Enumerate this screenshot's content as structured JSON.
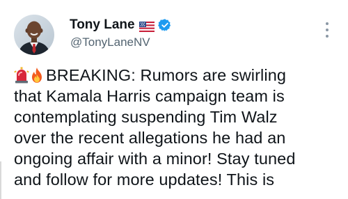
{
  "profile": {
    "display_name": "Tony Lane",
    "handle": "@TonyLaneNV",
    "flag_icon": "us-flag-icon",
    "verified_icon": "verified-badge-icon",
    "verified_color": "#1d9bf0"
  },
  "tweet": {
    "lead_icons": [
      "siren-icon",
      "fire-icon"
    ],
    "text": "BREAKING: Rumors are swirling\nthat Kamala Harris campaign team is\ncontemplating suspending Tim Walz\nover the recent allegations he had an\nongoing affair with a minor! Stay tuned\nand follow for more updates! This is"
  },
  "menu": {
    "icon": "more-options-icon"
  },
  "colors": {
    "text": "#0f1419",
    "secondary_text": "#536471",
    "accent": "#1d9bf0"
  }
}
